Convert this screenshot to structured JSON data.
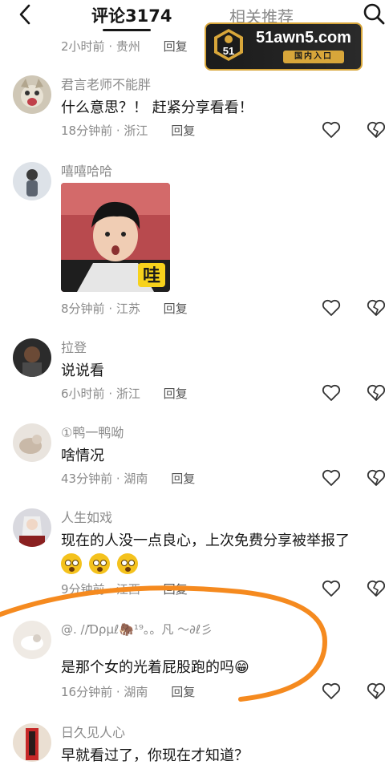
{
  "header": {
    "active_tab": "评论3174",
    "other_tab": "相关推荐"
  },
  "ad": {
    "badge_text": "51",
    "url": "51awn5.com",
    "sub": "国内入口"
  },
  "comments": [
    {
      "name": "",
      "text": "",
      "time": "2小时前",
      "location": "贵州",
      "reply": "回复"
    },
    {
      "name": "君言老师不能胖",
      "text": "什么意思？！ 赶紧分享看看！",
      "time": "18分钟前",
      "location": "浙江",
      "reply": "回复"
    },
    {
      "name": "嘻嘻哈哈",
      "text": "",
      "image_caption": "哇",
      "time": "8分钟前",
      "location": "江苏",
      "reply": "回复"
    },
    {
      "name": "拉登",
      "text": "说说看",
      "time": "6小时前",
      "location": "浙江",
      "reply": "回复"
    },
    {
      "name": "①鸭一鸭呦",
      "text": "啥情况",
      "time": "43分钟前",
      "location": "湖南",
      "reply": "回复"
    },
    {
      "name": "人生如戏",
      "text": "现在的人没一点良心，上次免费分享被举报了",
      "time": "9分钟前",
      "location": "江西",
      "reply": "回复"
    },
    {
      "name": "@. //Ɗρμℓ🦣¹⁹。。凡 ～∂ℓ彡",
      "text": "是那个女的光着屁股跑的吗😁",
      "time": "16分钟前",
      "location": "湖南",
      "reply": "回复"
    },
    {
      "name": "日久见人心",
      "text": "早就看过了，你现在才知道？",
      "time": "",
      "location": "",
      "reply": ""
    }
  ],
  "colors": {
    "highlight_ring": "#f58a1f",
    "ad_gold": "#d8a63a"
  }
}
